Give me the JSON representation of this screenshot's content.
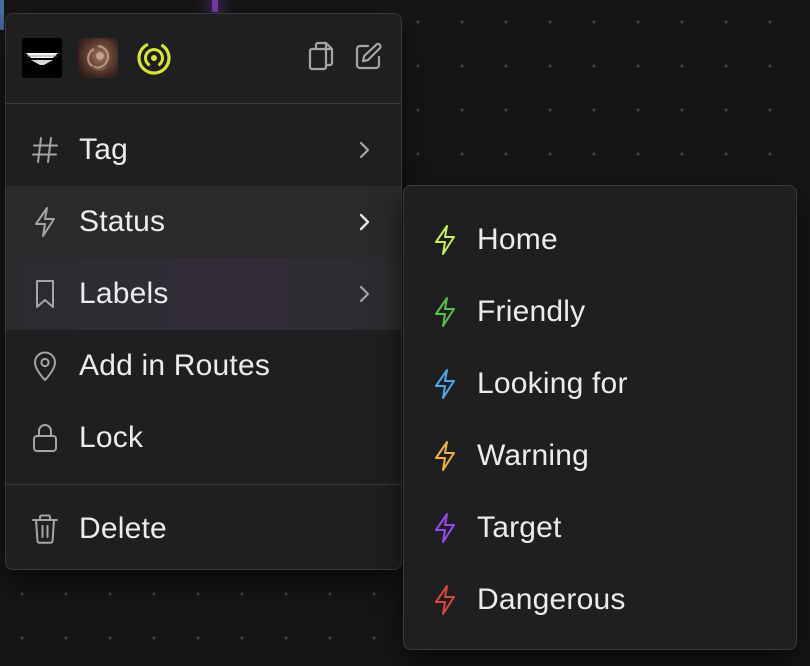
{
  "menu": {
    "avatars": [
      {
        "name": "avatar-dark-emblem"
      },
      {
        "name": "avatar-creature-portrait"
      },
      {
        "name": "avatar-target-emblem"
      }
    ],
    "actions": {
      "copy_icon": "copy-icon",
      "edit_icon": "edit-icon"
    },
    "items": [
      {
        "label": "Tag",
        "icon": "hash-icon",
        "submenu": true
      },
      {
        "label": "Status",
        "icon": "bolt-icon",
        "submenu": true
      },
      {
        "label": "Labels",
        "icon": "bookmark-icon",
        "submenu": true
      },
      {
        "label": "Add in Routes",
        "icon": "map-pin-icon",
        "submenu": false
      },
      {
        "label": "Lock",
        "icon": "lock-icon",
        "submenu": false
      }
    ],
    "delete": {
      "label": "Delete",
      "icon": "trash-icon"
    }
  },
  "status_submenu": {
    "items": [
      {
        "label": "Home",
        "color": "#c6f05a"
      },
      {
        "label": "Friendly",
        "color": "#55c24a"
      },
      {
        "label": "Looking for",
        "color": "#4fa8ee"
      },
      {
        "label": "Warning",
        "color": "#f0b23e"
      },
      {
        "label": "Target",
        "color": "#9a48f2"
      },
      {
        "label": "Dangerous",
        "color": "#d9473f"
      }
    ]
  },
  "colors": {
    "menu_bg": "#1f1f21",
    "border": "#3a3a3c",
    "text": "#ececec",
    "icon": "#a5a5a8",
    "emblem_yellow": "#d7e634"
  }
}
